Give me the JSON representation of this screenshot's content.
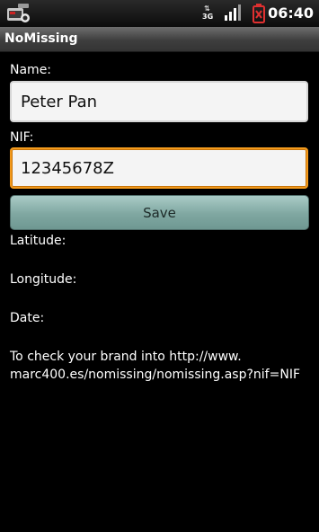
{
  "status_bar": {
    "time": "06:40",
    "network_type": "3G",
    "icons": [
      "notification-icon",
      "network-3g-icon",
      "signal-icon",
      "battery-icon"
    ]
  },
  "app": {
    "title": "NoMissing"
  },
  "form": {
    "name_label": "Name:",
    "name_value": "Peter Pan",
    "nif_label": "NIF:",
    "nif_value": "12345678Z",
    "save_label": "Save"
  },
  "details": {
    "latitude_label": "Latitude:",
    "longitude_label": "Longitude:",
    "date_label": "Date:"
  },
  "info": {
    "text": "To check your brand into http://www.\nmarc400.es/nomissing/nomissing.asp?nif=NIF"
  },
  "colors": {
    "focus_border": "#f39a1c",
    "button_fill": "#7fa7a1",
    "background": "#000000"
  }
}
